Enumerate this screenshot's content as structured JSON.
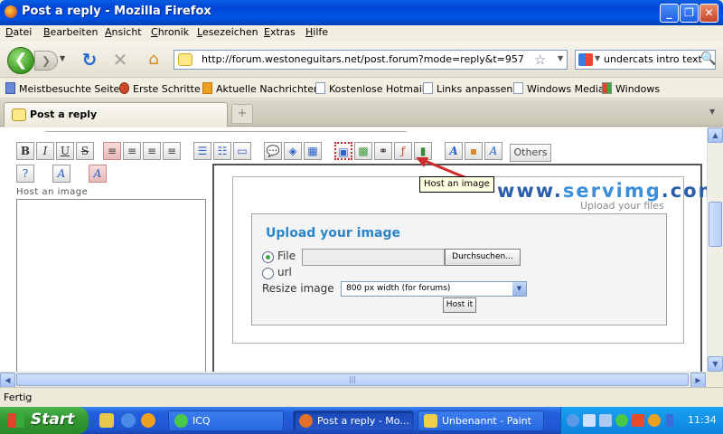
{
  "window": {
    "title": "Post a reply - Mozilla Firefox"
  },
  "menubar": {
    "items": [
      "Datei",
      "Bearbeiten",
      "Ansicht",
      "Chronik",
      "Lesezeichen",
      "Extras",
      "Hilfe"
    ]
  },
  "navbar": {
    "url": "http://forum.westoneguitars.net/post.forum?mode=reply&t=957",
    "search_text": "undercats intro text"
  },
  "bookmarks": {
    "items": [
      "Meistbesuchte Seiten",
      "Erste Schritte",
      "Aktuelle Nachrichten",
      "Kostenlose Hotmail",
      "Links anpassen",
      "Windows Media",
      "Windows"
    ]
  },
  "tabs": {
    "active_label": "Post a reply"
  },
  "editor": {
    "toolbar": {
      "bold": "B",
      "italic": "I",
      "underline": "U",
      "strike": "S",
      "others_label": "Others"
    },
    "host_image_label": "Host an image",
    "tooltip": "Host an image"
  },
  "servimg": {
    "logo_part1": "www.",
    "logo_part2": "servimg",
    "logo_part3": ".com",
    "tagline": "Upload your files",
    "upload_title": "Upload your image",
    "file_label": "File",
    "url_label": "url",
    "browse_label": "Durchsuchen...",
    "resize_label": "Resize image",
    "resize_value": "800 px width (for forums)",
    "host_button": "Host it",
    "selected_source": "File"
  },
  "status": {
    "text": "Fertig"
  },
  "taskbar": {
    "start_label": "Start",
    "tasks": [
      "ICQ",
      "Post a reply - Mo...",
      "Unbenannt - Paint"
    ],
    "active_task": "Post a reply - Mo...",
    "clock": "11:34"
  },
  "colors": {
    "titlebar": "#0046d5",
    "servimg_blue": "#2a86c8",
    "tooltip_bg": "#ffffe1",
    "highlight_red": "#d02a2a"
  }
}
